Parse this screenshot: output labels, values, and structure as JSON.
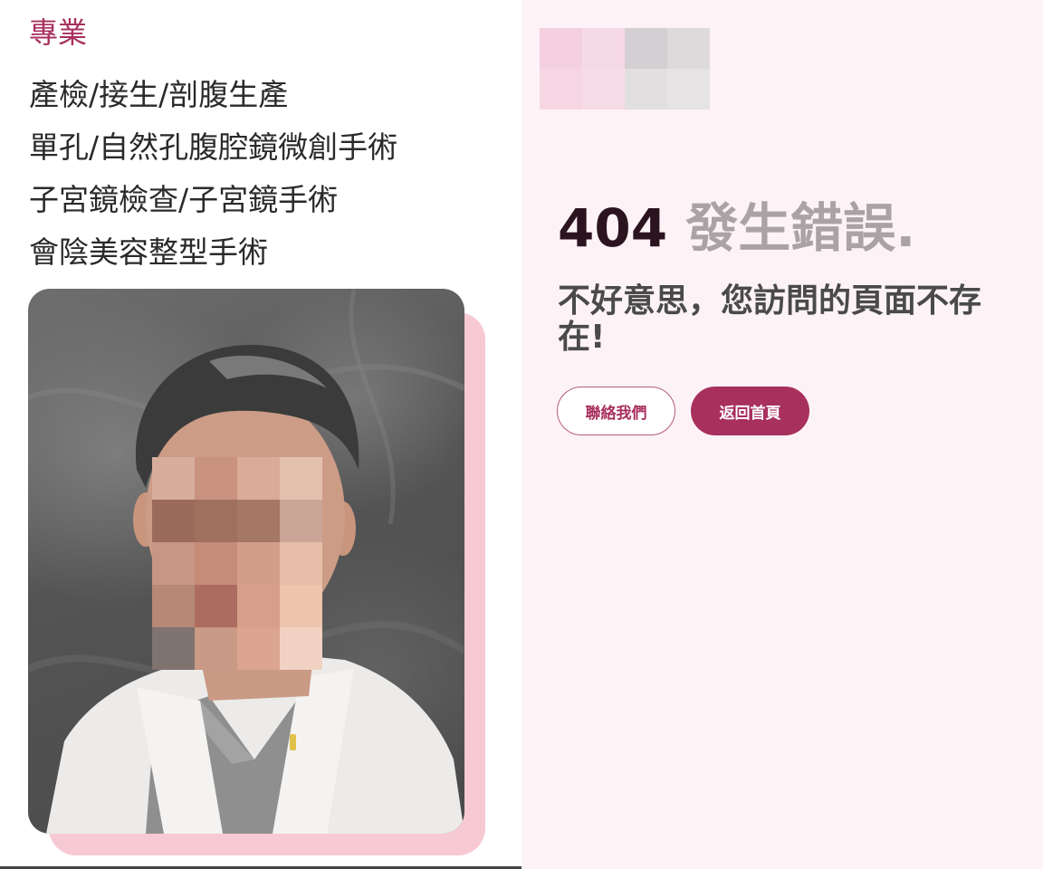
{
  "left": {
    "section_title": "專業",
    "specialties": [
      "產檢/接生/剖腹生產",
      "單孔/自然孔腹腔鏡微創手術",
      "子宮鏡檢查/子宮鏡手術",
      "會陰美容整型手術"
    ],
    "photo_icon": "doctor-portrait-blurred"
  },
  "right": {
    "logo_icon": "clinic-logo-pixelated",
    "error_code": "404",
    "error_text": "發生錯誤.",
    "message": "不好意思，您訪問的頁面不存在!",
    "buttons": {
      "contact": "聯絡我們",
      "home": "返回首頁"
    }
  },
  "colors": {
    "accent": "#a8305d",
    "right_background": "#fdf3f6",
    "photo_shadow": "#f7c9d3",
    "heading_dark": "#2b1420",
    "heading_muted": "#a9a3a6"
  }
}
